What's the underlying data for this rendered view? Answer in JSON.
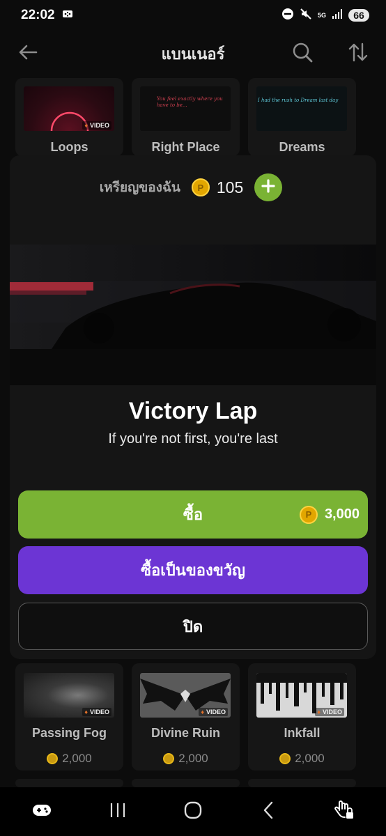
{
  "status_bar": {
    "time": "22:02",
    "network": "5G",
    "battery": "66"
  },
  "header": {
    "title": "แบนเนอร์"
  },
  "top_row": [
    {
      "name": "Loops",
      "badge": "VIDEO"
    },
    {
      "name": "Right Place",
      "thumb_text": "You feel exactly where you have to be..."
    },
    {
      "name": "Dreams",
      "thumb_text": "I had the rush to Dream last day"
    }
  ],
  "modal": {
    "coins_label": "เหรียญของฉัน",
    "coins_amount": "105",
    "banner_name": "Victory Lap",
    "banner_subtitle": "If you're not first, you're last",
    "buy_label": "ซื้อ",
    "buy_price": "3,000",
    "gift_label": "ซื้อเป็นของขวัญ",
    "close_label": "ปิด"
  },
  "bottom_row": [
    {
      "name": "Passing Fog",
      "badge": "VIDEO",
      "price": "2,000"
    },
    {
      "name": "Divine Ruin",
      "badge": "VIDEO",
      "price": "2,000"
    },
    {
      "name": "Inkfall",
      "badge": "VIDEO",
      "price": "2,000"
    }
  ],
  "colors": {
    "buy_green": "#7ab334",
    "gift_purple": "#6c35d4",
    "coin_gold": "#e2a600",
    "modal_bg": "#151515"
  },
  "icons": {
    "back": "arrow-left-icon",
    "search": "search-icon",
    "sort": "sort-icon",
    "coin": "coin-icon",
    "add": "plus-icon"
  }
}
